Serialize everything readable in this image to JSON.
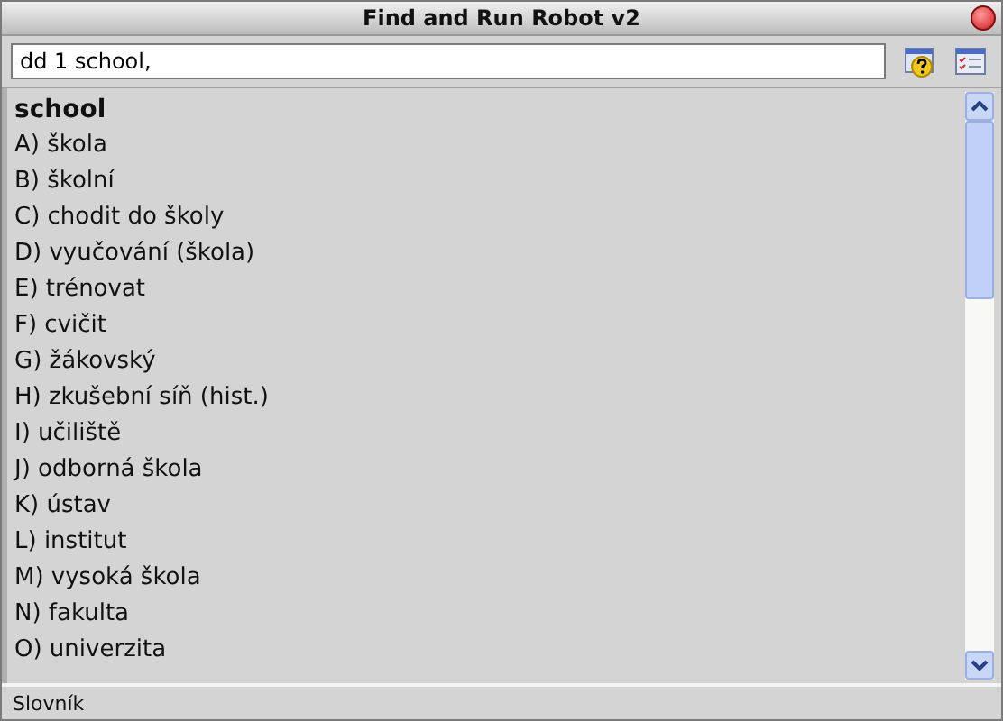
{
  "window": {
    "title": "Find and Run Robot v2"
  },
  "search": {
    "value": "dd 1 school,"
  },
  "results": {
    "heading": "school",
    "items": [
      "A) škola",
      "B) školní",
      "C) chodit do školy",
      "D) vyučování (škola)",
      "E) trénovat",
      "F) cvičit",
      "G) žákovský",
      "H) zkušební síň (hist.)",
      "I) učiliště",
      "J) odborná škola",
      "K) ústav",
      "L) institut",
      "M) vysoká škola",
      "N) fakulta",
      "O) univerzita"
    ]
  },
  "status_bar": {
    "text": "Slovník"
  }
}
